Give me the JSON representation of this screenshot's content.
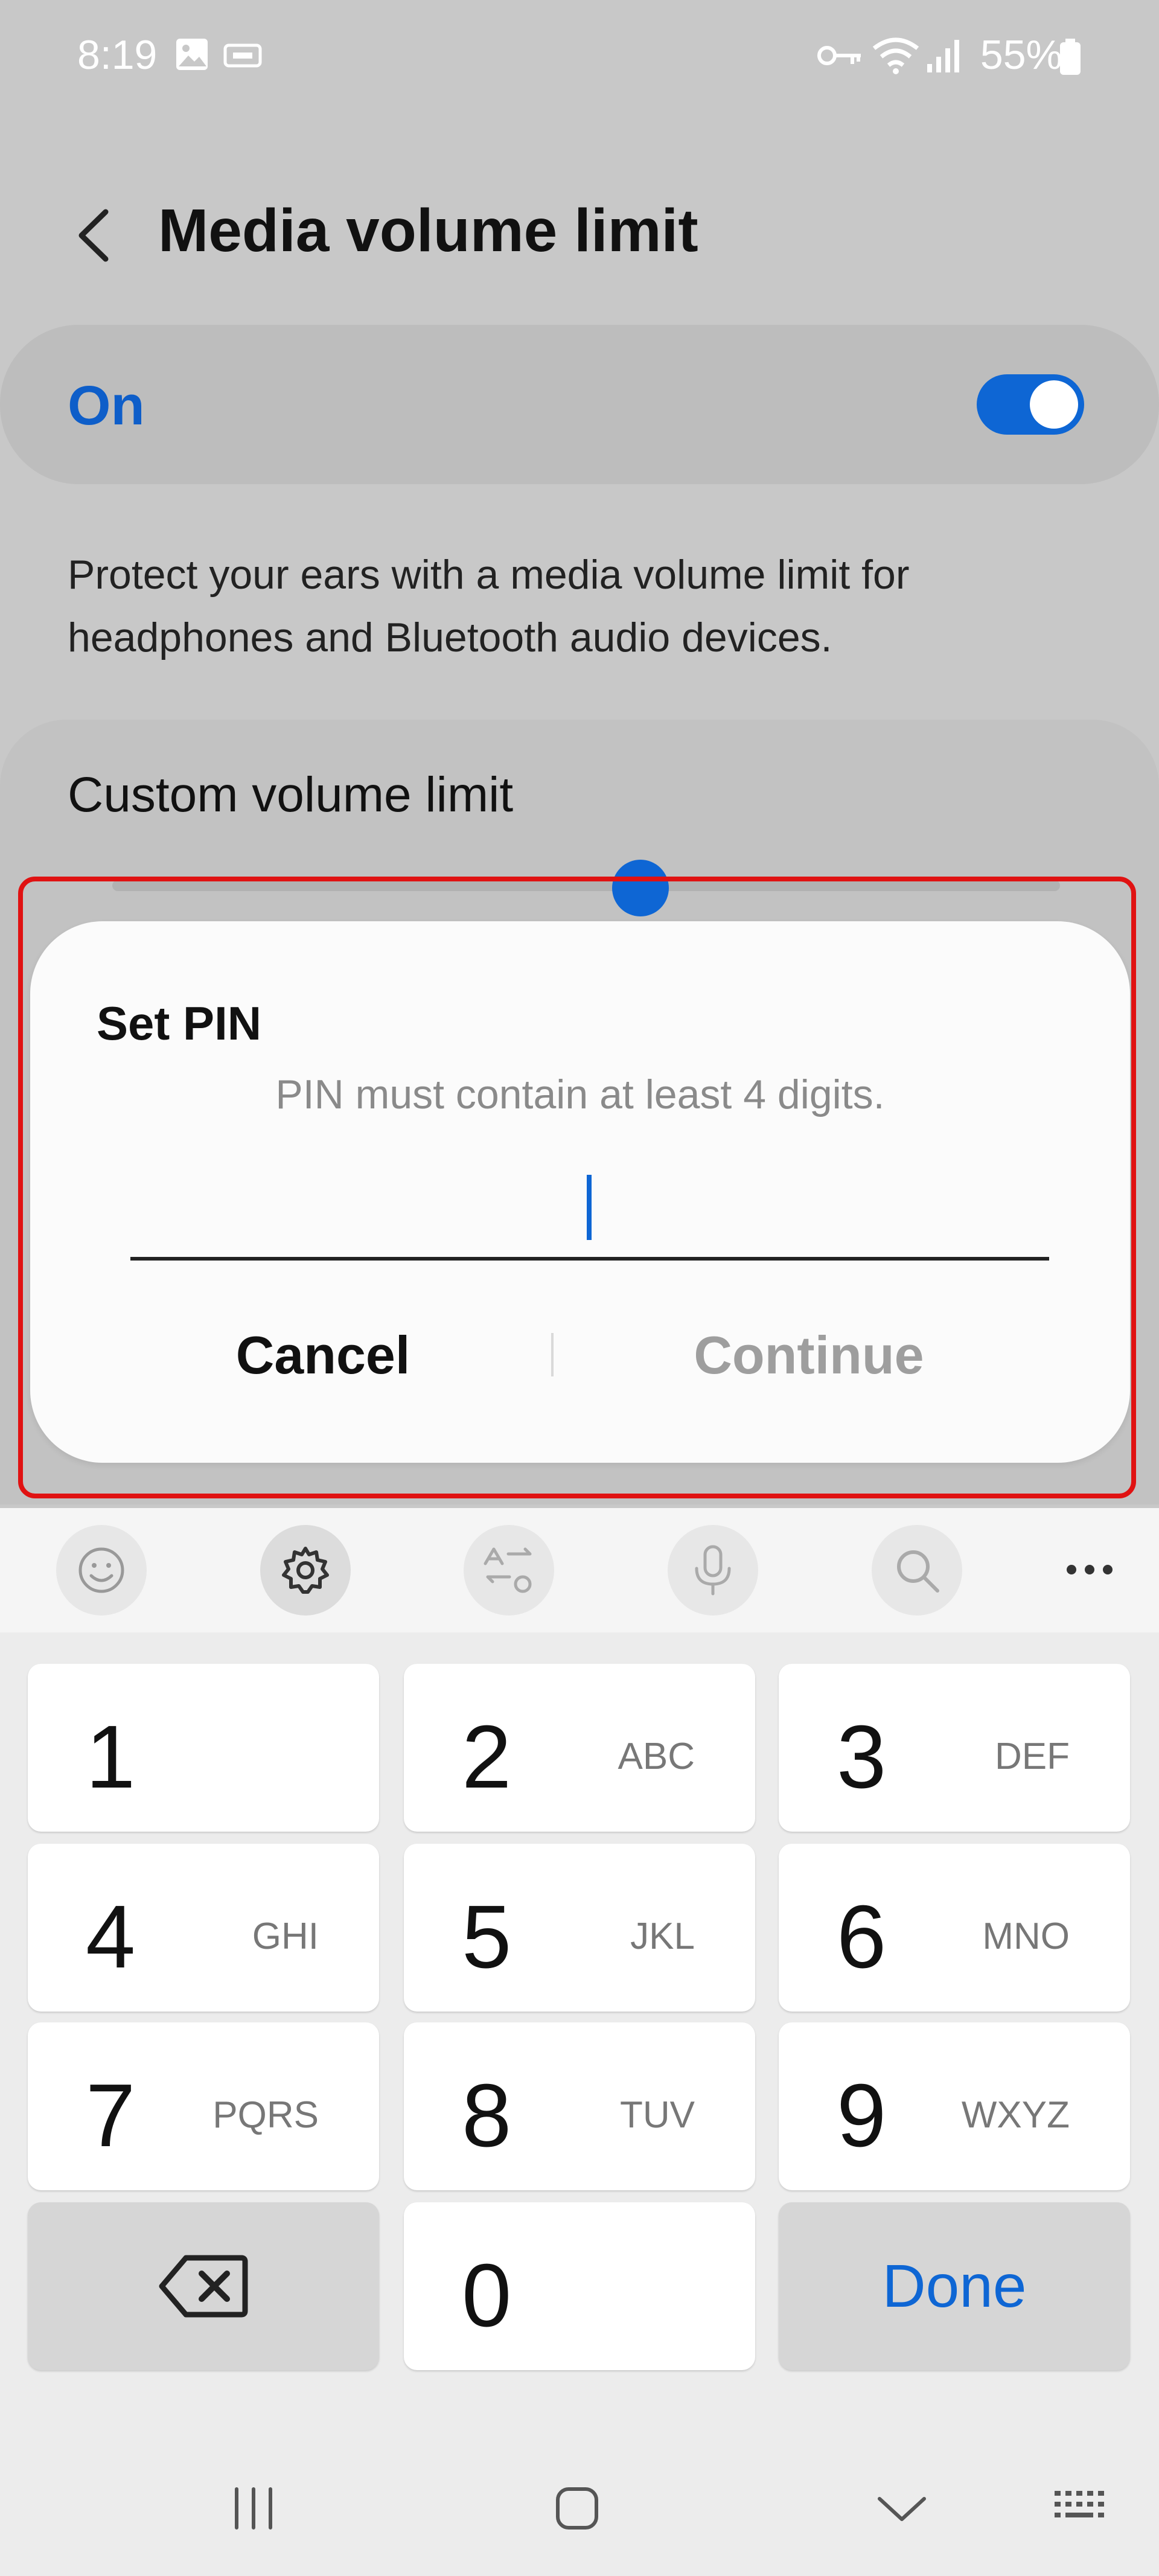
{
  "status_bar": {
    "time": "8:19",
    "battery": "55%"
  },
  "header": {
    "title": "Media volume limit"
  },
  "on_card": {
    "label": "On",
    "toggle_state": "on"
  },
  "description": "Protect your ears with a media volume limit for headphones and Bluetooth audio devices.",
  "volume_card": {
    "label": "Custom volume limit",
    "slider_level_fraction": 0.53
  },
  "dialog": {
    "title": "Set PIN",
    "hint": "PIN must contain at least 4 digits.",
    "pin_value": "",
    "cancel_label": "Cancel",
    "continue_label": "Continue"
  },
  "keyboard": {
    "toolbar": [
      "emoji-icon",
      "gear-icon",
      "text-convert-icon",
      "mic-icon",
      "search-icon",
      "more-icon"
    ],
    "keys": [
      {
        "num": "1",
        "letters": ""
      },
      {
        "num": "2",
        "letters": "ABC"
      },
      {
        "num": "3",
        "letters": "DEF"
      },
      {
        "num": "4",
        "letters": "GHI"
      },
      {
        "num": "5",
        "letters": "JKL"
      },
      {
        "num": "6",
        "letters": "MNO"
      },
      {
        "num": "7",
        "letters": "PQRS"
      },
      {
        "num": "8",
        "letters": "TUV"
      },
      {
        "num": "9",
        "letters": "WXYZ"
      },
      {
        "num": "0",
        "letters": ""
      }
    ],
    "done_label": "Done"
  },
  "colors": {
    "accent": "#0e66d4",
    "highlight": "#e01212",
    "background": "#c8c8c8"
  }
}
